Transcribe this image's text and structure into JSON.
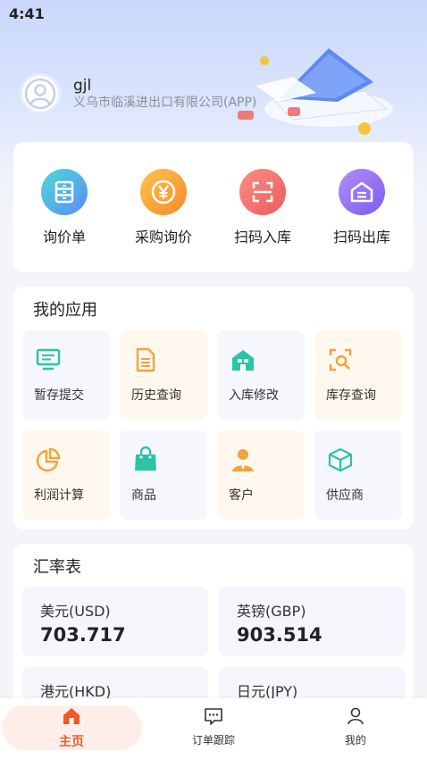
{
  "status": {
    "time": "4:41"
  },
  "profile": {
    "name": "gjl",
    "company": "义乌市临溪进出口有限公司(APP)"
  },
  "quick_actions": [
    {
      "label": "询价单",
      "icon": "cabinet-icon",
      "color": "#5aa8f5"
    },
    {
      "label": "采购询价",
      "icon": "yen-coin-icon",
      "color": "#f7a23a"
    },
    {
      "label": "扫码入库",
      "icon": "scan-icon",
      "color": "#f26b5e"
    },
    {
      "label": "扫码出库",
      "icon": "warehouse-icon",
      "color": "#9a74f0"
    }
  ],
  "apps": {
    "title": "我的应用",
    "items": [
      {
        "label": "暂存提交",
        "icon": "monitor-icon",
        "color": "#2bc4a4"
      },
      {
        "label": "历史查询",
        "icon": "document-icon",
        "color": "#f2a33a"
      },
      {
        "label": "入库修改",
        "icon": "store-icon",
        "color": "#2bc4a4"
      },
      {
        "label": "库存查询",
        "icon": "search-frame-icon",
        "color": "#f2a33a"
      },
      {
        "label": "利润计算",
        "icon": "pie-chart-icon",
        "color": "#f2a33a"
      },
      {
        "label": "商品",
        "icon": "shopping-bag-icon",
        "color": "#2bc4a4"
      },
      {
        "label": "客户",
        "icon": "person-icon",
        "color": "#f2a33a"
      },
      {
        "label": "供应商",
        "icon": "box-icon",
        "color": "#2bc4a4"
      }
    ]
  },
  "rates": {
    "title": "汇率表",
    "items": [
      {
        "name": "美元(USD)",
        "value": "703.717"
      },
      {
        "name": "英镑(GBP)",
        "value": "903.514"
      },
      {
        "name": "港元(HKD)",
        "value": ""
      },
      {
        "name": "日元(JPY)",
        "value": ""
      }
    ]
  },
  "tabs": [
    {
      "label": "主页",
      "icon": "home-icon",
      "active": true
    },
    {
      "label": "订单跟踪",
      "icon": "chat-icon",
      "active": false
    },
    {
      "label": "我的",
      "icon": "user-icon",
      "active": false
    }
  ],
  "colors": {
    "accent": "#f05a24",
    "teal": "#2bc4a4",
    "orange": "#f2a33a"
  }
}
